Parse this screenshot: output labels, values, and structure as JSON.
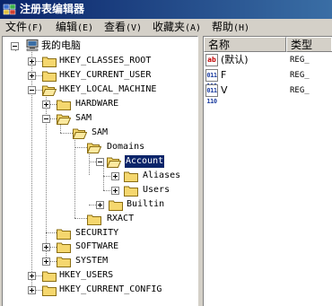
{
  "window": {
    "title": "注册表编辑器"
  },
  "menu": [
    {
      "label": "文件",
      "key": "(F)"
    },
    {
      "label": "编辑",
      "key": "(E)"
    },
    {
      "label": "查看",
      "key": "(V)"
    },
    {
      "label": "收藏夹",
      "key": "(A)"
    },
    {
      "label": "帮助",
      "key": "(H)"
    }
  ],
  "tree": {
    "root": "我的电脑",
    "nodes": [
      {
        "label": "HKEY_CLASSES_ROOT",
        "state": "collapsed"
      },
      {
        "label": "HKEY_CURRENT_USER",
        "state": "collapsed"
      },
      {
        "label": "HKEY_LOCAL_MACHINE",
        "state": "expanded"
      },
      {
        "label": "HARDWARE",
        "state": "collapsed"
      },
      {
        "label": "SAM",
        "state": "expanded"
      },
      {
        "label": "SAM",
        "state": "expanded"
      },
      {
        "label": "Domains",
        "state": "expanded"
      },
      {
        "label": "Account",
        "state": "expanded",
        "selected": true
      },
      {
        "label": "Aliases",
        "state": "collapsed"
      },
      {
        "label": "Users",
        "state": "collapsed"
      },
      {
        "label": "Builtin",
        "state": "collapsed"
      },
      {
        "label": "RXACT",
        "state": "leaf"
      },
      {
        "label": "SECURITY",
        "state": "leaf"
      },
      {
        "label": "SOFTWARE",
        "state": "collapsed"
      },
      {
        "label": "SYSTEM",
        "state": "collapsed"
      },
      {
        "label": "HKEY_USERS",
        "state": "collapsed"
      },
      {
        "label": "HKEY_CURRENT_CONFIG",
        "state": "collapsed"
      }
    ]
  },
  "list": {
    "columns": [
      "名称",
      "类型"
    ],
    "rows": [
      {
        "icon": "string-value-icon",
        "icon_text": "ab",
        "name": "(默认)",
        "type": "REG_"
      },
      {
        "icon": "binary-value-icon",
        "icon_text": "011 110",
        "name": "F",
        "type": "REG_"
      },
      {
        "icon": "binary-value-icon",
        "icon_text": "011 110",
        "name": "V",
        "type": "REG_"
      }
    ]
  },
  "colors": {
    "titlebar_start": "#0a246a",
    "titlebar_end": "#3a6ea5",
    "selection": "#0a246a",
    "folder": "#f5d76e",
    "window_bg": "#d4d0c8"
  }
}
